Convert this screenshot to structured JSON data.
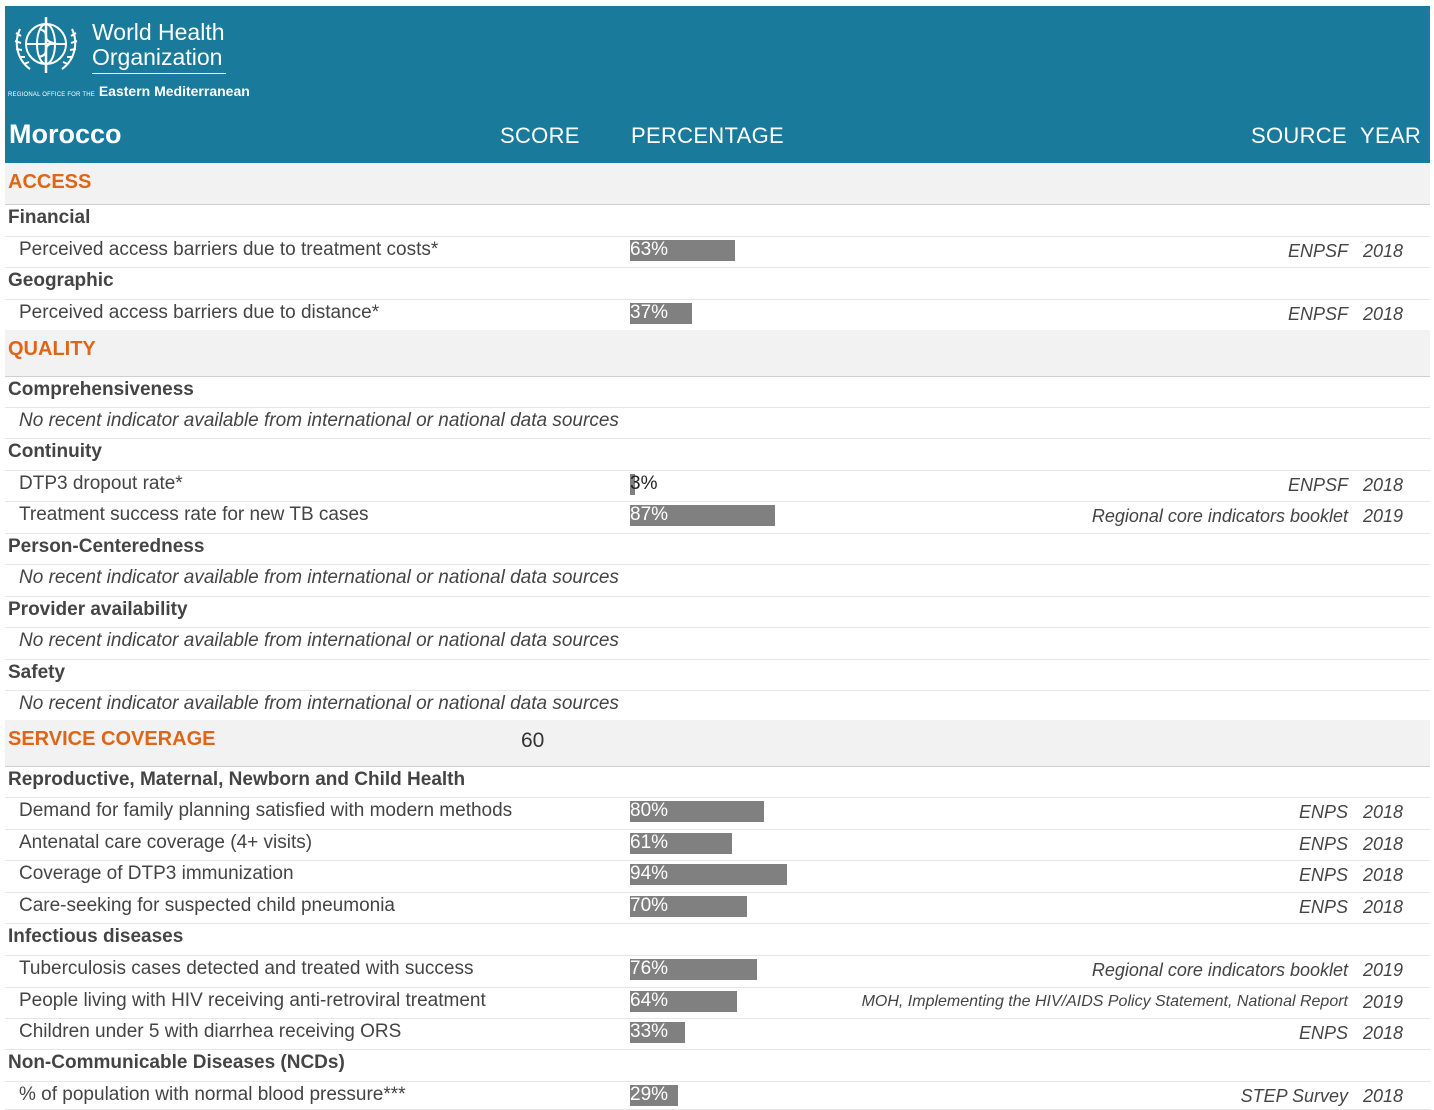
{
  "header": {
    "logo_line1": "World Health",
    "logo_line2": "Organization",
    "logo_small": "REGIONAL OFFICE FOR THE",
    "logo_region": "Eastern Mediterranean",
    "country": "Morocco",
    "col_score": "SCORE",
    "col_percentage": "PERCENTAGE",
    "col_source": "SOURCE",
    "col_year": "YEAR"
  },
  "colors": {
    "header_bg": "#1a7a9b",
    "category_text": "#e06516",
    "bar": "#808080",
    "category_bg": "#f2f2f2"
  },
  "rows": [
    {
      "kind": "category",
      "label": "ACCESS"
    },
    {
      "kind": "sub",
      "label": "Financial"
    },
    {
      "kind": "ind",
      "label": "Perceived access barriers due to treatment costs*",
      "pct": 63,
      "pct_text": "63%",
      "source": "ENPSF",
      "year": "2018"
    },
    {
      "kind": "sub",
      "label": "Geographic"
    },
    {
      "kind": "ind",
      "label": "Perceived access barriers due to distance*",
      "pct": 37,
      "pct_text": "37%",
      "source": "ENPSF",
      "year": "2018"
    },
    {
      "kind": "category",
      "label": "QUALITY"
    },
    {
      "kind": "sub",
      "label": "Comprehensiveness"
    },
    {
      "kind": "na",
      "label": "No recent indicator available from international or national data sources"
    },
    {
      "kind": "sub",
      "label": "Continuity"
    },
    {
      "kind": "ind",
      "label": "DTP3 dropout rate*",
      "pct": 3,
      "pct_text": "3%",
      "source": "ENPSF",
      "year": "2018"
    },
    {
      "kind": "ind",
      "label": "Treatment success rate for new TB cases",
      "pct": 87,
      "pct_text": "87%",
      "source": "Regional core indicators booklet",
      "year": "2019"
    },
    {
      "kind": "sub",
      "label": "Person-Centeredness"
    },
    {
      "kind": "na",
      "label": "No recent indicator available from international or national data sources"
    },
    {
      "kind": "sub",
      "label": "Provider availability"
    },
    {
      "kind": "na",
      "label": "No recent indicator available from international or national data sources"
    },
    {
      "kind": "sub",
      "label": "Safety"
    },
    {
      "kind": "na",
      "label": "No recent indicator available from international or national data sources"
    },
    {
      "kind": "category",
      "label": "SERVICE COVERAGE",
      "score": "60"
    },
    {
      "kind": "sub",
      "label": "Reproductive, Maternal, Newborn and Child Health"
    },
    {
      "kind": "ind",
      "label": "Demand for family planning satisfied with modern methods",
      "pct": 80,
      "pct_text": "80%",
      "source": "ENPS",
      "year": "2018"
    },
    {
      "kind": "ind",
      "label": "Antenatal care coverage (4+ visits)",
      "pct": 61,
      "pct_text": "61%",
      "source": "ENPS",
      "year": "2018"
    },
    {
      "kind": "ind",
      "label": "Coverage of DTP3 immunization",
      "pct": 94,
      "pct_text": "94%",
      "source": "ENPS",
      "year": "2018"
    },
    {
      "kind": "ind",
      "label": "Care-seeking for suspected child pneumonia",
      "pct": 70,
      "pct_text": "70%",
      "source": "ENPS",
      "year": "2018"
    },
    {
      "kind": "sub",
      "label": "Infectious diseases"
    },
    {
      "kind": "ind",
      "label": "Tuberculosis cases detected and treated with success",
      "pct": 76,
      "pct_text": "76%",
      "source": "Regional core indicators booklet",
      "year": "2019"
    },
    {
      "kind": "ind",
      "label": "People living with HIV receiving anti-retroviral treatment",
      "pct": 64,
      "pct_text": "64%",
      "source": "MOH, Implementing the HIV/AIDS Policy Statement, National Report",
      "year": "2019"
    },
    {
      "kind": "ind",
      "label": "Children under 5 with diarrhea receiving ORS",
      "pct": 33,
      "pct_text": "33%",
      "source": "ENPS",
      "year": "2018"
    },
    {
      "kind": "sub",
      "label": "Non-Communicable Diseases (NCDs)"
    },
    {
      "kind": "ind",
      "label": "% of population with normal blood pressure***",
      "pct": 29,
      "pct_text": "29%",
      "source": "STEP Survey",
      "year": "2018"
    }
  ]
}
